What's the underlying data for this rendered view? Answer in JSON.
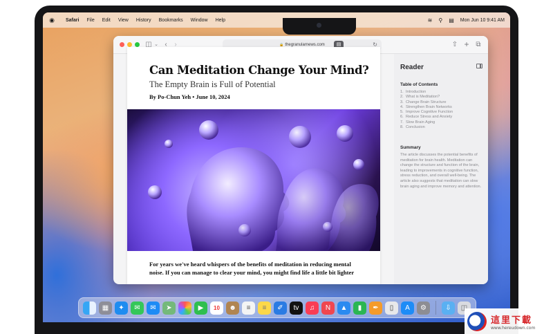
{
  "menubar": {
    "apple": "",
    "items": [
      "Safari",
      "File",
      "Edit",
      "View",
      "History",
      "Bookmarks",
      "Window",
      "Help"
    ],
    "datetime": "Mon Jun 10  9:41 AM"
  },
  "browser": {
    "url": "thegranularnews.com"
  },
  "article": {
    "title": "Can Meditation Change Your Mind?",
    "subtitle": "The Empty Brain is Full of Potential",
    "byline": "By Po-Chun Yeh  •  June 10, 2024",
    "body": "For years we've heard whispers of the benefits of meditation in reducing mental noise. If you can manage to clear your mind, you might find life a little bit lighter"
  },
  "reader": {
    "title": "Reader",
    "toc_heading": "Table of Contents",
    "toc": [
      {
        "n": "1.",
        "label": "Introduction"
      },
      {
        "n": "2.",
        "label": "What is Meditation?"
      },
      {
        "n": "3.",
        "label": "Change Brain Structure"
      },
      {
        "n": "4.",
        "label": "Strengthen Brain Networks"
      },
      {
        "n": "5.",
        "label": "Improve Cognitive Function"
      },
      {
        "n": "6.",
        "label": "Reduce Stress and Anxiety"
      },
      {
        "n": "7.",
        "label": "Slow Brain Aging"
      },
      {
        "n": "8.",
        "label": "Conclusion"
      }
    ],
    "summary_heading": "Summary",
    "summary": "The article discusses the potential benefits of meditation for brain health. Meditation can change the structure and function of the brain, leading to improvements in cognitive function, stress reduction, and overall well-being. The article also suggests that meditation can slow brain aging and improve memory and attention."
  },
  "dock": {
    "calendar_day": "10"
  },
  "watermark": {
    "title": "這里下載",
    "sub": "www.hereudown.com"
  }
}
